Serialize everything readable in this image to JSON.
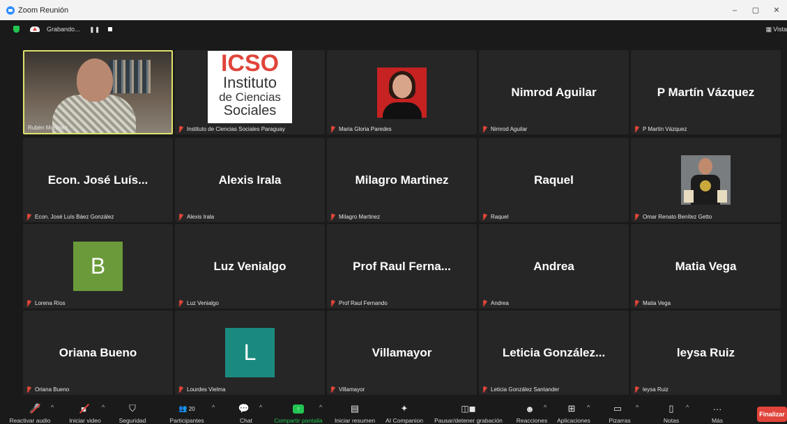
{
  "window": {
    "title": "Zoom Reunión",
    "controls": [
      "–",
      "▢",
      "✕"
    ]
  },
  "status": {
    "recording_label": "Grabando...",
    "pause_icon": "pause-icon",
    "stop_icon": "stop-icon",
    "view_label": "Vista"
  },
  "tiles": [
    {
      "label": "Rubén Martínez",
      "type": "photo",
      "active": true,
      "muted": false
    },
    {
      "label": "Instituto de Ciencias Sociales Paraguay",
      "type": "logo",
      "muted": true,
      "logo": {
        "l1": "ICSO",
        "l2": "Instituto",
        "l3": "de Ciencias",
        "l4": "Sociales"
      }
    },
    {
      "label": "Maria Gloria Paredes",
      "type": "photo-small",
      "muted": true
    },
    {
      "label": "Nimrod Aguilar",
      "big": "Nimrod Aguilar",
      "type": "name",
      "muted": true
    },
    {
      "label": "P Martín Vázquez",
      "big": "P Martín Vázquez",
      "type": "name",
      "muted": true
    },
    {
      "label": "Econ. José Luís Báez González",
      "big": "Econ. José Luís...",
      "type": "name",
      "muted": true
    },
    {
      "label": "Alexis Irala",
      "big": "Alexis Irala",
      "type": "name",
      "muted": true
    },
    {
      "label": "Milagro Martinez",
      "big": "Milagro Martinez",
      "type": "name",
      "muted": true
    },
    {
      "label": "Raquel",
      "big": "Raquel",
      "type": "name",
      "muted": true
    },
    {
      "label": "Omar Renato Benítez Getto",
      "type": "photo-small2",
      "muted": true
    },
    {
      "label": "Lorena Ríos",
      "type": "avatar",
      "avatar": "B",
      "color": "#6a9a3a",
      "muted": true
    },
    {
      "label": "Luz Venialgo",
      "big": "Luz Venialgo",
      "type": "name",
      "muted": true
    },
    {
      "label": "Prof Raul Fernando",
      "big": "Prof Raul Ferna...",
      "type": "name",
      "muted": true
    },
    {
      "label": "Andrea",
      "big": "Andrea",
      "type": "name",
      "muted": true
    },
    {
      "label": "Matia Vega",
      "big": "Matia Vega",
      "type": "name",
      "muted": true
    },
    {
      "label": "Oriana Bueno",
      "big": "Oriana Bueno",
      "type": "name",
      "muted": true
    },
    {
      "label": "Lourdes Vielma",
      "type": "avatar",
      "avatar": "L",
      "color": "#1b8a7e",
      "muted": true
    },
    {
      "label": "Villamayor",
      "big": "Villamayor",
      "type": "name",
      "muted": true
    },
    {
      "label": "Leticia González Santander",
      "big": "Leticia González...",
      "type": "name",
      "muted": true
    },
    {
      "label": "leysa Ruiz",
      "big": "leysa Ruiz",
      "type": "name",
      "muted": true
    }
  ],
  "toolbar": {
    "audio": "Reactivar audio",
    "video": "Iniciar video",
    "security": "Seguridad",
    "participants": "Participantes",
    "participants_count": "20",
    "chat": "Chat",
    "share": "Compartir pantalla",
    "summary": "Iniciar resumen",
    "companion": "AI Companion",
    "record": "Pausar/detener grabación",
    "reactions": "Reacciones",
    "apps": "Aplicaciones",
    "whiteboards": "Pizarras",
    "notes": "Notas",
    "more": "Más",
    "end": "Finalizar"
  },
  "colors": {
    "accent_green": "#23c552",
    "active_speaker": "#dfe36c",
    "end_red": "#e0443a"
  }
}
